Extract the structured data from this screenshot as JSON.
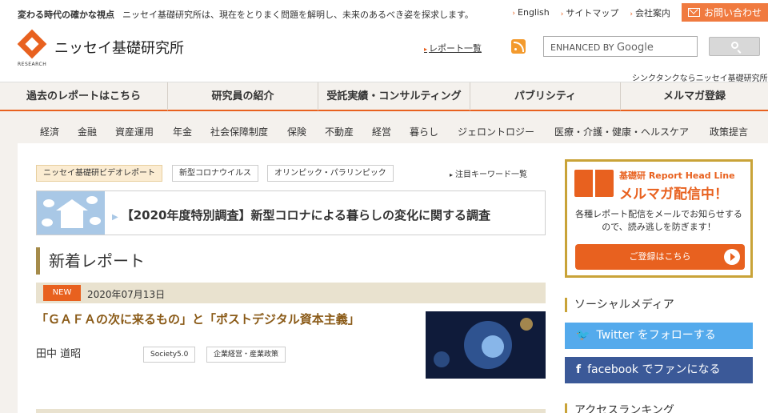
{
  "header": {
    "tagline_lead": "変わる時代の確かな視点",
    "tagline_body": "ニッセイ基礎研究所は、現在をとりまく問題を解明し、未来のあるべき姿を探求します。",
    "links": [
      "English",
      "サイトマップ",
      "会社案内"
    ],
    "contact_label": "お問い合わせ",
    "logo_name": "ニッセイ基礎研究所",
    "logo_sub": "RESEARCH",
    "report_list_label": "レポート一覧",
    "search_prefix": "ENHANCED BY",
    "search_brand": "Google",
    "think_tank_text": "シンクタンクならニッセイ基礎研究所"
  },
  "global_nav": [
    "過去のレポートはこちら",
    "研究員の紹介",
    "受託実績・コンサルティング",
    "パブリシティ",
    "メルマガ登録"
  ],
  "category_nav": [
    "経済",
    "金融",
    "資産運用",
    "年金",
    "社会保障制度",
    "保険",
    "不動産",
    "経営",
    "暮らし",
    "ジェロントロジー",
    "医療・介護・健康・ヘルスケア",
    "政策提言"
  ],
  "keywords": [
    "ニッセイ基礎研ビデオレポート",
    "新型コロナウイルス",
    "オリンピック・パラリンピック"
  ],
  "keyword_list_label": "注目キーワード一覧",
  "banner_text": "【2020年度特別調査】新型コロナによる暮らしの変化に関する調査",
  "section_title": "新着レポート",
  "article": {
    "badge": "NEW",
    "date": "2020年07月13日",
    "title": "「ＧＡＦＡの次に来るもの」と「ポストデジタル資本主義」",
    "author": "田中 道昭",
    "tags": [
      "Society5.0",
      "企業経営・産業政策"
    ]
  },
  "sidebar": {
    "mail_sub": "基礎研 Report Head Line",
    "mail_main": "メルマガ配信中！",
    "mail_desc": "各種レポート配信をメールでお知らせするので、読み逃しを防ぎます！",
    "mail_button": "ご登録はこちら",
    "social_title": "ソーシャルメディア",
    "twitter_label": "Twitter をフォローする",
    "facebook_label": "facebook でファンになる",
    "ranking_title": "アクセスランキング"
  },
  "colors": {
    "accent": "#e8611f",
    "gold": "#c9a338",
    "twitter": "#54aaec",
    "facebook": "#3b5998"
  }
}
